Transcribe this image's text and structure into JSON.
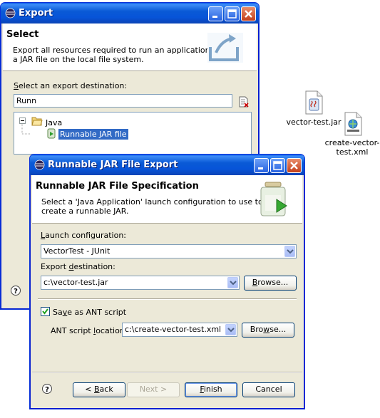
{
  "desktop": {
    "files": [
      {
        "name": "vector-test.jar",
        "icon": "jar-file-icon"
      },
      {
        "name": "create-vector-test.xml",
        "label_lines": [
          "create-vector-",
          "test.xml"
        ],
        "icon": "xml-file-icon"
      }
    ]
  },
  "export_dialog": {
    "title": "Export",
    "header_title": "Select",
    "header_desc_lines": [
      "Export all resources required to run an application into",
      "a JAR file on the local file system."
    ],
    "dest_label": "Select an export destination:",
    "filter_value": "Runn",
    "tree": {
      "folder": "Java",
      "item": "Runnable JAR file"
    }
  },
  "jar_dialog": {
    "title": "Runnable JAR File Export",
    "header_title": "Runnable JAR File Specification",
    "header_desc_lines": [
      "Select a 'Java Application' launch configuration to use to",
      "create a runnable JAR."
    ],
    "launch_label": "Launch configuration:",
    "launch_value": "VectorTest - JUnit",
    "dest_label": "Export destination:",
    "dest_value": "c:\\vector-test.jar",
    "browse_label": "Browse...",
    "ant_checkbox_label": "Save as ANT script",
    "ant_checked": true,
    "ant_location_label": "ANT script location:",
    "ant_location_value": "c:\\create-vector-test.xml",
    "ant_browse_label": "Browse...",
    "buttons": {
      "back": "< Back",
      "next": "Next >",
      "finish": "Finish",
      "cancel": "Cancel"
    }
  },
  "colors": {
    "titlebar": "#0a5ce8",
    "dialog_bg": "#ece9d8",
    "selection": "#316ac5"
  }
}
